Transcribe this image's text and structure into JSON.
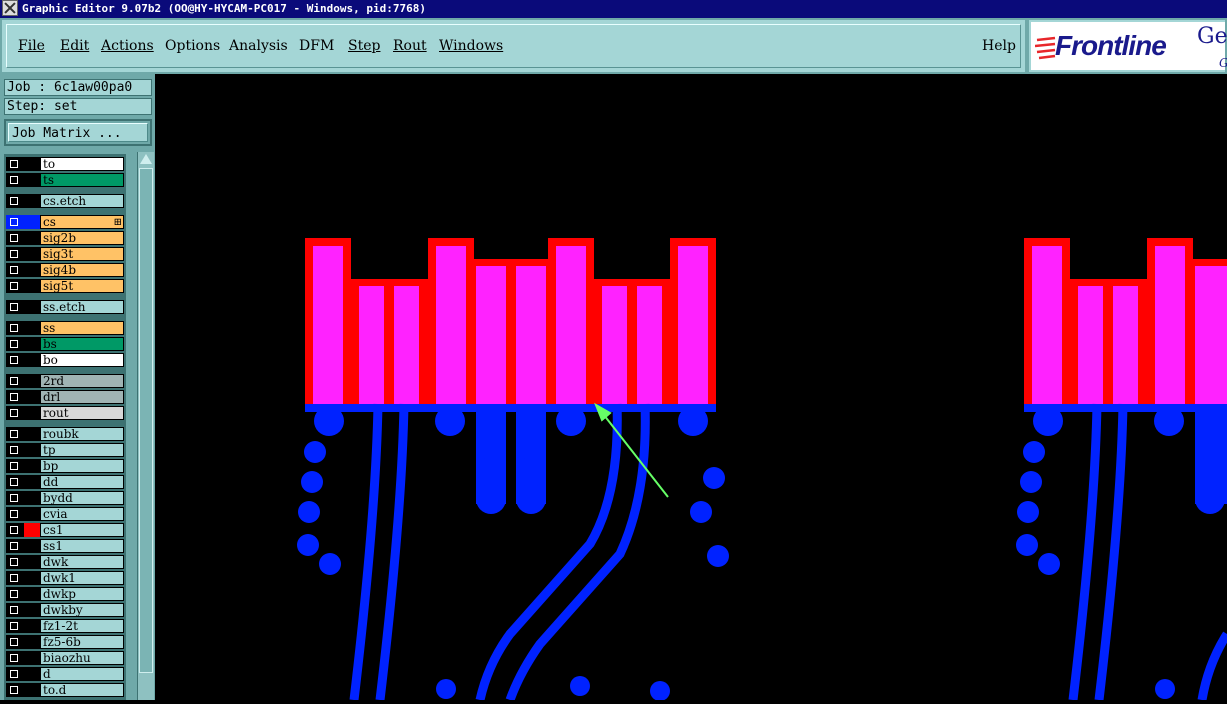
{
  "window": {
    "title": "Graphic Editor 9.07b2 (OO@HY-HYCAM-PC017 - Windows, pid:7768)"
  },
  "menu": [
    {
      "label": "File",
      "ul": true
    },
    {
      "label": "Edit",
      "ul": true
    },
    {
      "label": "Actions",
      "ul": true
    },
    {
      "label": "Options",
      "ul": false
    },
    {
      "label": "Analysis",
      "ul": false
    },
    {
      "label": "DFM",
      "ul": false
    },
    {
      "label": "Step",
      "ul": true
    },
    {
      "label": "Rout",
      "ul": true
    },
    {
      "label": "Windows",
      "ul": true
    },
    {
      "label": "Help",
      "ul": false
    }
  ],
  "logo": {
    "brand": "Frontline",
    "side": "Ge",
    "sub": "G"
  },
  "job": {
    "job_label": "Job : 6c1aw00pa0",
    "step_label": "Step: set",
    "matrix_button": "Job Matrix ..."
  },
  "colors": {
    "orange": "#ffc266",
    "green": "#009966",
    "white": "#ffffff",
    "cyan": "#a4d6d6",
    "gray": "#a0b4b4",
    "lightgray": "#d8d8d8",
    "board_red": "#ff0000",
    "board_magenta": "#ff22ff",
    "board_blue": "#0022ff",
    "arrow": "#66ff66"
  },
  "layers": [
    {
      "name": "to",
      "bg": "#ffffff",
      "color": "#000",
      "active": false
    },
    {
      "name": "ts",
      "bg": "#009966",
      "color": "#000",
      "active": false
    },
    {
      "name": "cs.etch",
      "bg": "#a4d6d6",
      "color": "#000",
      "active": false,
      "gap": true
    },
    {
      "name": "cs",
      "bg": "#ffc266",
      "color": "#0022ff",
      "active": true,
      "gap": true
    },
    {
      "name": "sig2b",
      "bg": "#ffc266",
      "color": "#000",
      "active": false
    },
    {
      "name": "sig3t",
      "bg": "#ffc266",
      "color": "#000",
      "active": false
    },
    {
      "name": "sig4b",
      "bg": "#ffc266",
      "color": "#000",
      "active": false
    },
    {
      "name": "sig5t",
      "bg": "#ffc266",
      "color": "#000",
      "active": false
    },
    {
      "name": "ss.etch",
      "bg": "#a4d6d6",
      "color": "#000",
      "active": false,
      "gap": true
    },
    {
      "name": "ss",
      "bg": "#ffc266",
      "color": "#000",
      "active": false,
      "gap": true
    },
    {
      "name": "bs",
      "bg": "#009966",
      "color": "#000",
      "active": false
    },
    {
      "name": "bo",
      "bg": "#ffffff",
      "color": "#000",
      "active": false
    },
    {
      "name": "2rd",
      "bg": "#a0b4b4",
      "color": "#000",
      "active": false,
      "gap": true
    },
    {
      "name": "drl",
      "bg": "#a0b4b4",
      "color": "#000",
      "active": false
    },
    {
      "name": "rout",
      "bg": "#d8d8d8",
      "color": "#000",
      "active": false
    },
    {
      "name": "roubk",
      "bg": "#a4d6d6",
      "color": "#000",
      "active": false,
      "gap": true
    },
    {
      "name": "tp",
      "bg": "#a4d6d6",
      "color": "#000",
      "active": false
    },
    {
      "name": "bp",
      "bg": "#a4d6d6",
      "color": "#000",
      "active": false
    },
    {
      "name": "dd",
      "bg": "#a4d6d6",
      "color": "#000",
      "active": false
    },
    {
      "name": "bydd",
      "bg": "#a4d6d6",
      "color": "#000",
      "active": false
    },
    {
      "name": "cvia",
      "bg": "#a4d6d6",
      "color": "#000",
      "active": false
    },
    {
      "name": "cs1",
      "bg": "#a4d6d6",
      "color": "#ff0000",
      "active": false
    },
    {
      "name": "ss1",
      "bg": "#a4d6d6",
      "color": "#000",
      "active": false
    },
    {
      "name": "dwk",
      "bg": "#a4d6d6",
      "color": "#000",
      "active": false
    },
    {
      "name": "dwk1",
      "bg": "#a4d6d6",
      "color": "#000",
      "active": false
    },
    {
      "name": "dwkp",
      "bg": "#a4d6d6",
      "color": "#000",
      "active": false
    },
    {
      "name": "dwkby",
      "bg": "#a4d6d6",
      "color": "#000",
      "active": false
    },
    {
      "name": "fz1-2t",
      "bg": "#a4d6d6",
      "color": "#000",
      "active": false
    },
    {
      "name": "fz5-6b",
      "bg": "#a4d6d6",
      "color": "#000",
      "active": false
    },
    {
      "name": "biaozhu",
      "bg": "#a4d6d6",
      "color": "#000",
      "active": false
    },
    {
      "name": "d",
      "bg": "#a4d6d6",
      "color": "#000",
      "active": false
    },
    {
      "name": "to.d",
      "bg": "#a4d6d6",
      "color": "#000",
      "active": false
    }
  ]
}
